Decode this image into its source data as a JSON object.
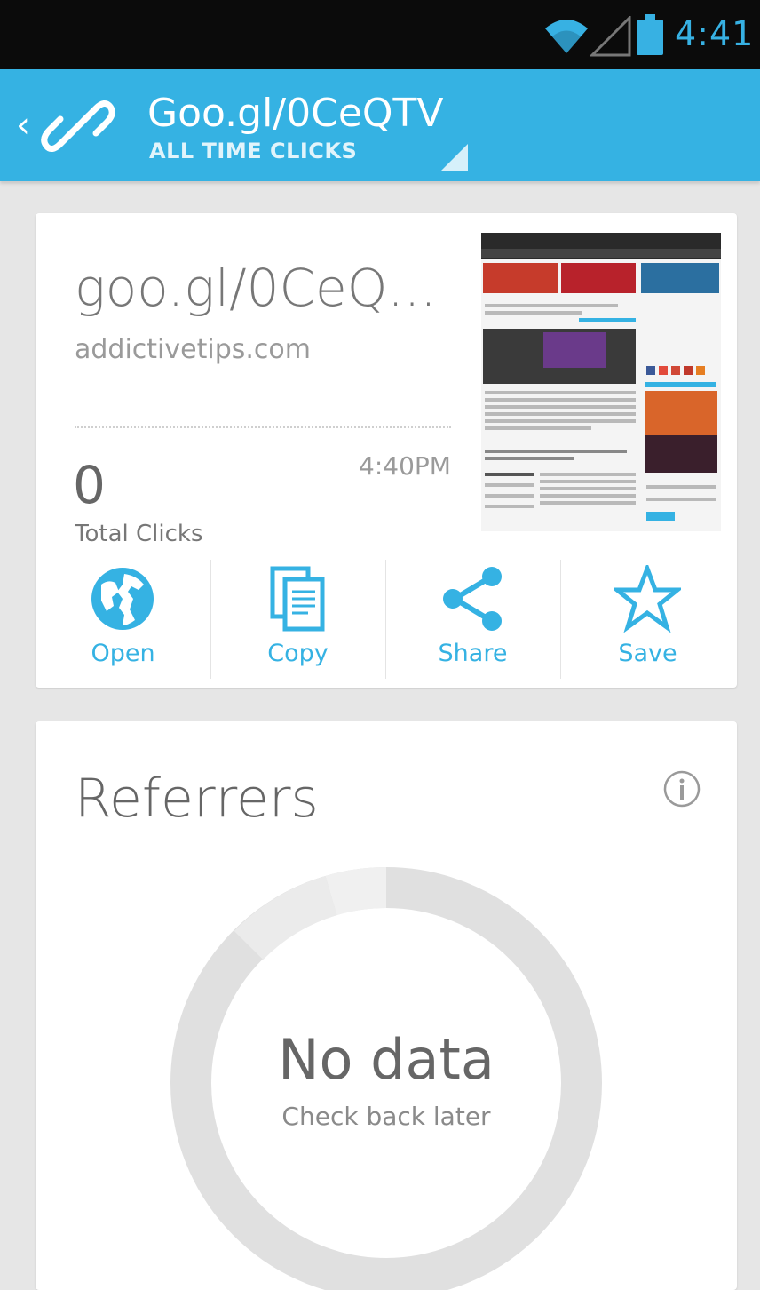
{
  "status_bar": {
    "time": "4:41",
    "icons": [
      "wifi-icon",
      "signal-icon",
      "battery-icon"
    ],
    "accent": "#37b1e3"
  },
  "action_bar": {
    "title": "Goo.gl/0CeQTV",
    "subtitle": "ALL TIME CLICKS",
    "background": "#35b2e3"
  },
  "link_card": {
    "short_url": "goo.gl/0CeQ...",
    "domain": "addictivetips.com",
    "total_clicks": "0",
    "total_clicks_label": "Total Clicks",
    "created_time": "4:40PM",
    "actions": [
      {
        "label": "Open",
        "icon": "globe-icon"
      },
      {
        "label": "Copy",
        "icon": "copy-icon"
      },
      {
        "label": "Share",
        "icon": "share-icon"
      },
      {
        "label": "Save",
        "icon": "star-icon"
      }
    ]
  },
  "referrers_card": {
    "title": "Referrers",
    "empty_title": "No data",
    "empty_subtitle": "Check back later"
  }
}
